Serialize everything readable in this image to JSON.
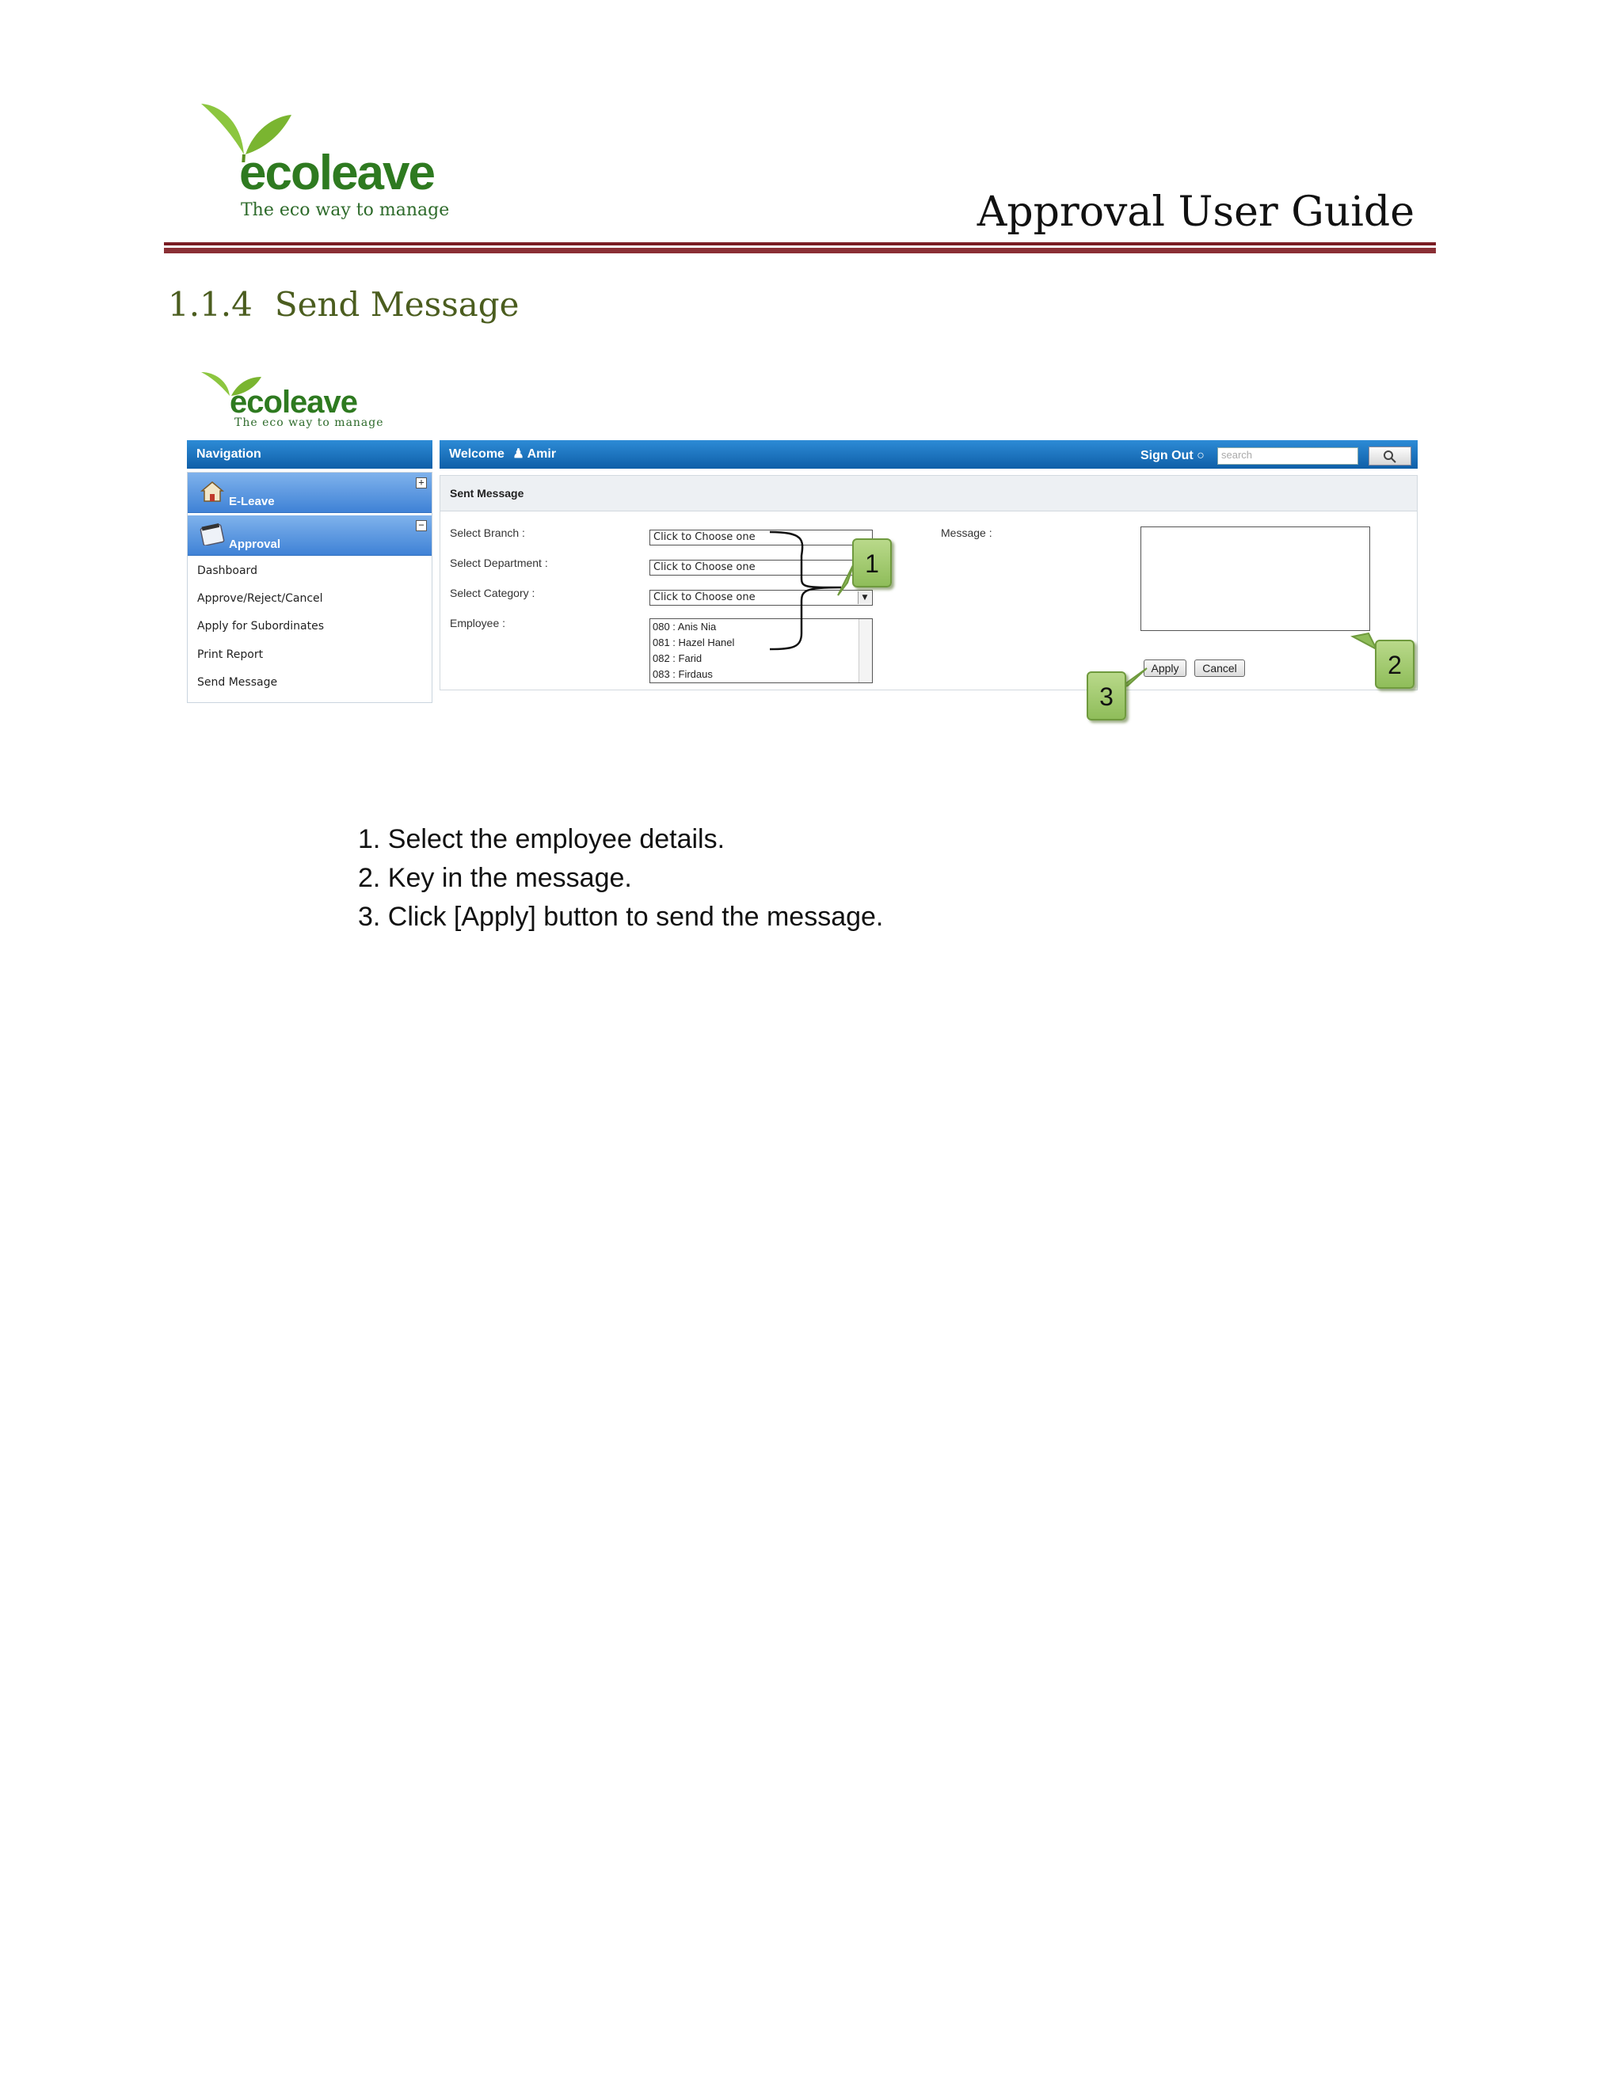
{
  "document": {
    "logo": {
      "brand_eco": "eco",
      "brand_leave": "leave",
      "tagline": "The eco way to manage"
    },
    "header_title": "Approval User Guide",
    "section": {
      "number": "1.1.4",
      "title": "Send Message"
    },
    "steps": [
      "1. Select the employee details.",
      "2. Key in the message.",
      "3. Click [Apply] button to send the message."
    ]
  },
  "app": {
    "logo": {
      "brand_eco": "eco",
      "brand_leave": "leave",
      "tagline": "The eco way to manage"
    },
    "nav_title": "Navigation",
    "welcome": "Welcome",
    "user": "Amir",
    "sign_out": "Sign Out",
    "search_placeholder": "search",
    "sidebar": {
      "sections": [
        {
          "label": "E-Leave",
          "icon": "home-icon",
          "toggle": "+"
        },
        {
          "label": "Approval",
          "icon": "calendar-icon",
          "toggle": "−"
        }
      ],
      "links": [
        "Dashboard",
        "Approve/Reject/Cancel",
        "Apply for Subordinates",
        "Print Report",
        "Send Message"
      ]
    },
    "form": {
      "title": "Sent Message",
      "branch_label": "Select Branch  :",
      "department_label": "Select Department  :",
      "category_label": "Select Category  :",
      "employee_label": "Employee  :",
      "select_placeholder": "Click to Choose one",
      "employees": [
        "080 : Anis Nia",
        "081 : Hazel Hanel",
        "082 : Farid",
        "083 : Firdaus"
      ],
      "message_label": "Message  :",
      "apply_label": "Apply",
      "cancel_label": "Cancel"
    },
    "callouts": [
      "1",
      "2",
      "3"
    ]
  },
  "colors": {
    "header_rule": "#7a1c22",
    "section_title": "#4b5d1f",
    "app_bar": "#1a6fbd",
    "callout": "#a6cb72"
  }
}
